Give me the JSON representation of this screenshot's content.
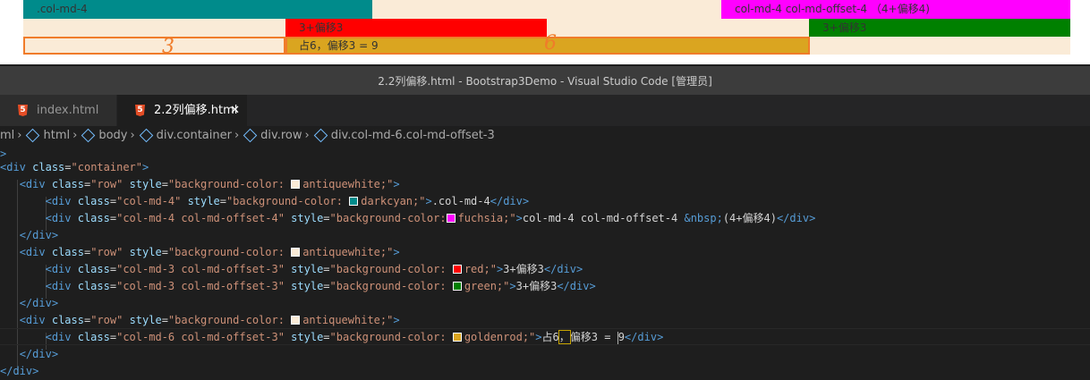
{
  "preview": {
    "row1": {
      "cell1": ".col-md-4",
      "cell2": "col-md-4 col-md-offset-4 （4+偏移4)"
    },
    "row2": {
      "cell1": "3+偏移3",
      "cell2": "3+偏移3"
    },
    "row3": {
      "cell1": "占6，偏移3 = 9"
    },
    "annotations": {
      "left": "3",
      "right": "6"
    },
    "colors": {
      "antiquewhite": "#faebd7",
      "darkcyan": "#008b8b",
      "fuchsia": "#ff00ff",
      "red": "#ff0000",
      "green": "#008000",
      "goldenrod": "#daa520",
      "annotation": "#f07c2a"
    }
  },
  "window": {
    "title": "2.2列偏移.html - Bootstrap3Demo - Visual Studio Code [管理员]"
  },
  "tabs": [
    {
      "label": "index.html",
      "icon": "html5-icon"
    },
    {
      "label": "2.2列偏移.html",
      "icon": "html5-icon",
      "close": "✕"
    }
  ],
  "breadcrumbs": [
    "ml",
    "html",
    "body",
    "div.container",
    "div.row",
    "div.col-md-6.col-md-offset-3"
  ],
  "code": {
    "l0": ">",
    "div": "div",
    "class_attr": "class",
    "style_attr": "style",
    "container": "\"container\"",
    "row": "\"row\"",
    "col4": "\"col-md-4\"",
    "col4off4": "\"col-md-4 col-md-offset-4\"",
    "col3off3": "\"col-md-3 col-md-offset-3\"",
    "col6off3": "\"col-md-6 col-md-offset-3\"",
    "bg_prefix": "\"background-color: ",
    "bg_prefix_nospace": "\"background-color:",
    "aw": "antiquewhite;\"",
    "dc": "darkcyan;\"",
    "fu": "fuchsia;\"",
    "rd": "red;\"",
    "gr": "green;\"",
    "gd": "goldenrod;\"",
    "txt_col4": ".col-md-4",
    "txt_off4": "col-md-4 col-md-offset-4 ",
    "nbsp": "&nbsp;",
    "txt_off4_b": "(4+偏移4)",
    "txt_33": "3+偏移3",
    "txt_6a": "占6",
    "txt_6b": "，",
    "txt_6c": "偏移3 = ",
    "txt_6d": "9"
  }
}
